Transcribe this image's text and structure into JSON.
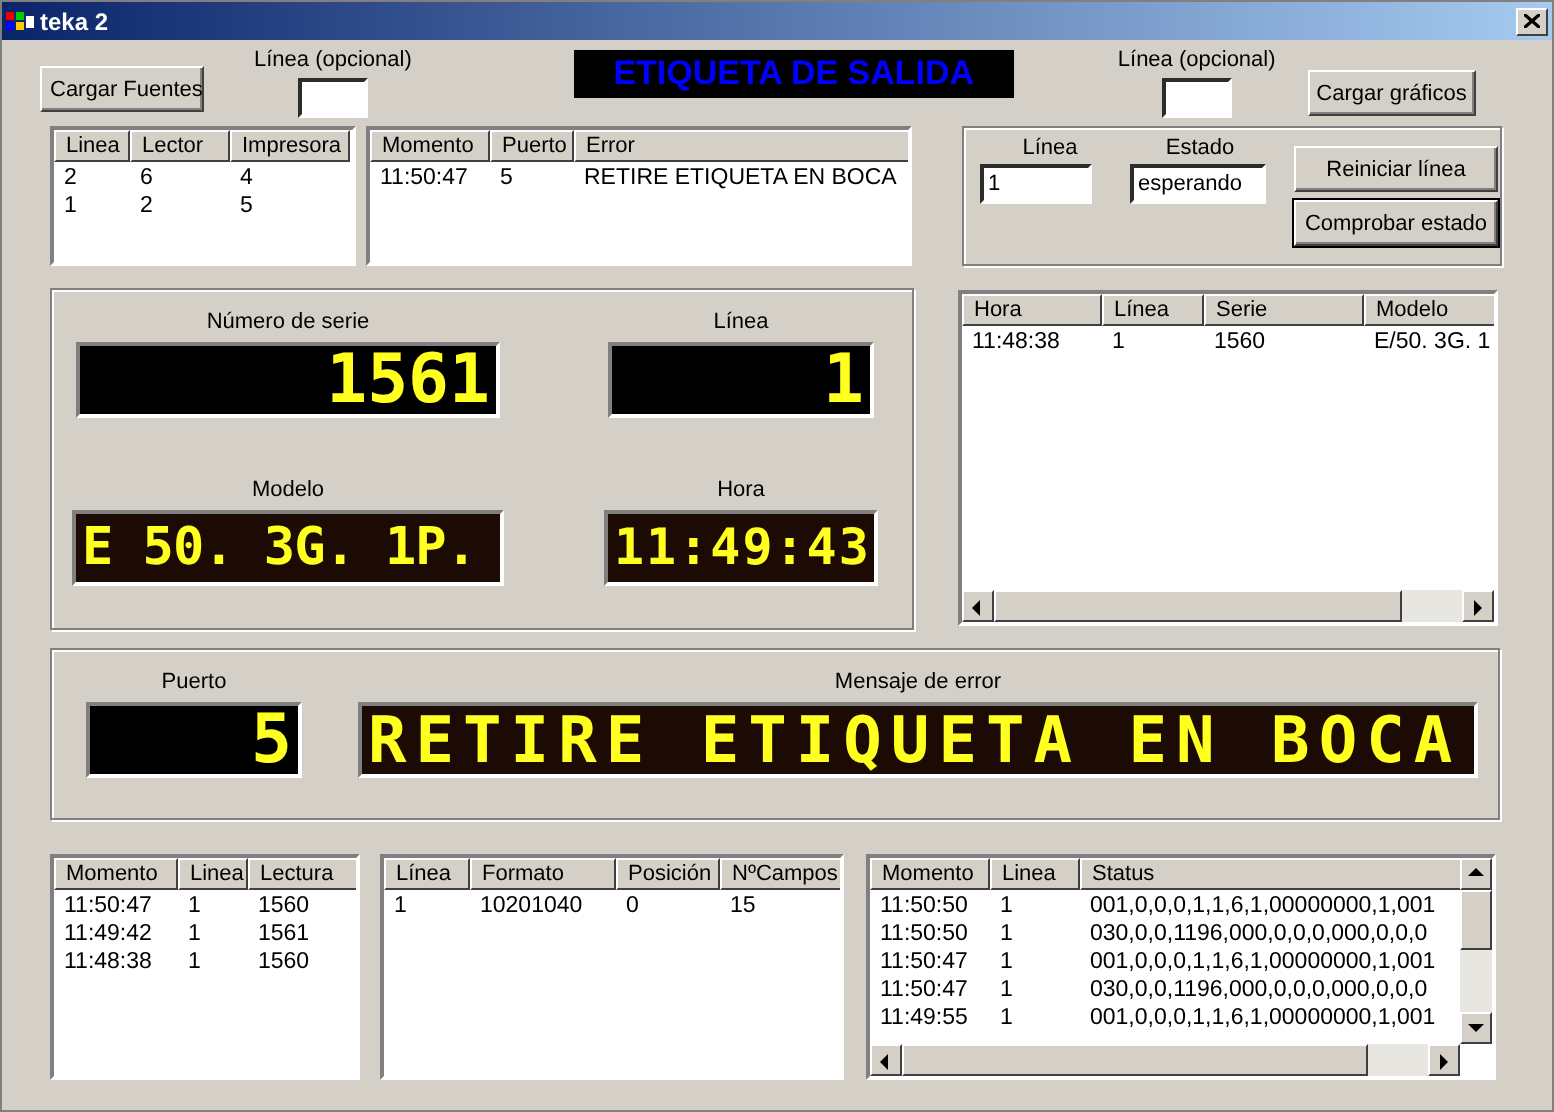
{
  "window": {
    "title": "teka 2"
  },
  "header": {
    "load_fonts_button": "Cargar Fuentes",
    "left_line_label": "Línea (opcional)",
    "title": "ETIQUETA DE SALIDA",
    "right_line_label": "Línea (opcional)",
    "load_graphics_button": "Cargar gráficos"
  },
  "readers_table": {
    "columns": [
      "Linea",
      "Lector",
      "Impresora"
    ],
    "rows": [
      [
        "2",
        "6",
        "4"
      ],
      [
        "1",
        "2",
        "5"
      ]
    ]
  },
  "errors_table": {
    "columns": [
      "Momento",
      "Puerto",
      "Error"
    ],
    "rows": [
      [
        "11:50:47",
        "5",
        "RETIRE ETIQUETA EN BOCA"
      ]
    ]
  },
  "line_status": {
    "line_label": "Línea",
    "line_value": "1",
    "state_label": "Estado",
    "state_value": "esperando",
    "buttons": [
      {
        "label": "Reiniciar línea",
        "focused": false
      },
      {
        "label": "Comprobar estado",
        "focused": true
      }
    ]
  },
  "reading_display": {
    "serial_label": "Número de serie",
    "serial": "1561",
    "line_label": "Línea",
    "line": "1",
    "model_label": "Modelo",
    "model": "E 50. 3G. 1P.",
    "time_label": "Hora",
    "time": "11:49:43"
  },
  "history_table": {
    "columns": [
      "Hora",
      "Línea",
      "Serie",
      "Modelo"
    ],
    "rows": [
      [
        "11:48:38",
        "1",
        "1560",
        "E/50. 3G. 1"
      ]
    ]
  },
  "error_display": {
    "port_label": "Puerto",
    "port": "5",
    "message_label": "Mensaje de error",
    "message": "RETIRE ETIQUETA EN BOCA"
  },
  "readings_table": {
    "columns": [
      "Momento",
      "Linea",
      "Lectura"
    ],
    "rows": [
      [
        "11:50:47",
        "1",
        "1560"
      ],
      [
        "11:49:42",
        "1",
        "1561"
      ],
      [
        "11:48:38",
        "1",
        "1560"
      ]
    ]
  },
  "formats_table": {
    "columns": [
      "Línea",
      "Formato",
      "Posición",
      "NºCampos"
    ],
    "rows": [
      [
        "1",
        "10201040",
        "0",
        "15"
      ]
    ]
  },
  "status_table": {
    "columns": [
      "Momento",
      "Linea",
      "Status"
    ],
    "rows": [
      [
        "11:50:50",
        "1",
        "001,0,0,0,1,1,6,1,00000000,1,001"
      ],
      [
        "11:50:50",
        "1",
        "030,0,0,1196,000,0,0,0,000,0,0,0"
      ],
      [
        "11:50:47",
        "1",
        "001,0,0,0,1,1,6,1,00000000,1,001"
      ],
      [
        "11:50:47",
        "1",
        "030,0,0,1196,000,0,0,0,000,0,0,0"
      ],
      [
        "11:49:55",
        "1",
        "001,0,0,0,1,1,6,1,00000000,1,001"
      ]
    ]
  }
}
